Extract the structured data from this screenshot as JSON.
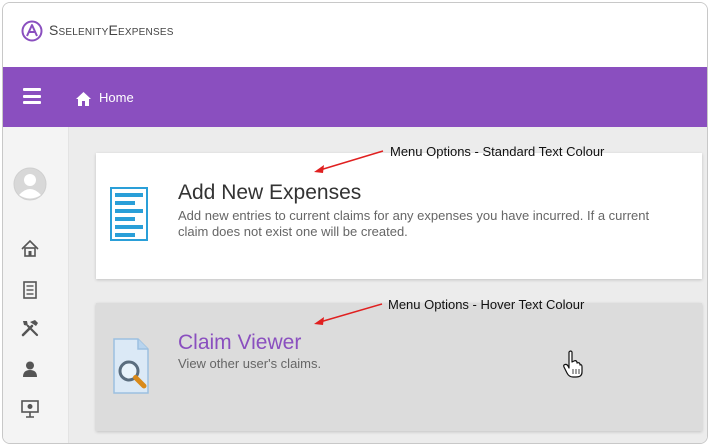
{
  "app": {
    "brand_first": "Selenity",
    "brand_second": "Expenses"
  },
  "navbar": {
    "home_label": "Home",
    "accent_color": "#8a4fbf"
  },
  "sidebar": {
    "icons": [
      "home-icon",
      "expenses-list-icon",
      "tools-icon",
      "user-icon",
      "presentation-icon"
    ]
  },
  "menu": {
    "items": [
      {
        "title": "Add New Expenses",
        "description": "Add new entries to current claims for any expenses you have incurred. If a current claim does not exist one will be created.",
        "icon": "document-list-icon"
      },
      {
        "title": "Claim Viewer",
        "description": "View other user's claims.",
        "icon": "claim-viewer-icon"
      }
    ]
  },
  "annotations": {
    "standard": "Menu Options - Standard Text Colour",
    "hover": "Menu Options - Hover Text Colour"
  }
}
